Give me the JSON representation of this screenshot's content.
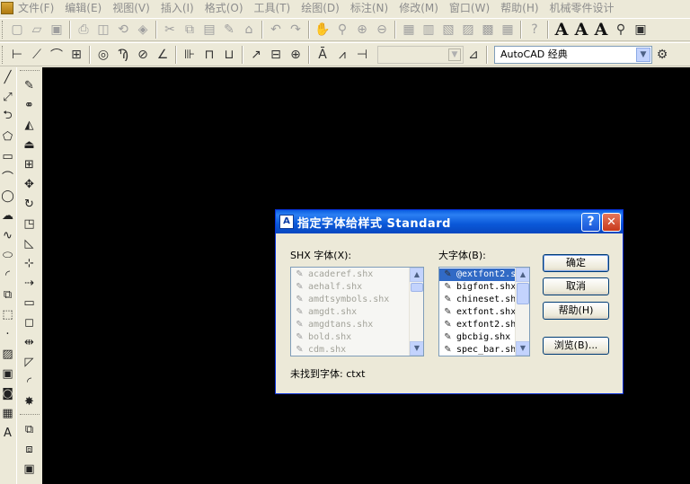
{
  "menu": {
    "items": [
      "文件(F)",
      "编辑(E)",
      "视图(V)",
      "插入(I)",
      "格式(O)",
      "工具(T)",
      "绘图(D)",
      "标注(N)",
      "修改(M)",
      "窗口(W)",
      "帮助(H)",
      "机械零件设计"
    ]
  },
  "toolbar": {
    "workspace_value": "AutoCAD 经典",
    "text_buttons": [
      "A",
      "A",
      "A"
    ]
  },
  "dialog": {
    "title": "指定字体给样式 Standard",
    "help_glyph": "?",
    "close_glyph": "✕",
    "shx_label": "SHX 字体(X):",
    "big_label": "大字体(B):",
    "shx_fonts": [
      "acaderef.shx",
      "aehalf.shx",
      "amdtsymbols.shx",
      "amgdt.shx",
      "amgdtans.shx",
      "bold.shx",
      "cdm.shx"
    ],
    "big_fonts": [
      "@extfont2.shx",
      "bigfont.shx",
      "chineset.shx",
      "extfont.shx",
      "extfont2.shx",
      "gbcbig.shx",
      "spec_bar.shx"
    ],
    "big_selected_index": 0,
    "buttons": {
      "ok": "确定",
      "cancel": "取消",
      "help": "帮助(H)",
      "browse": "浏览(B)..."
    },
    "status_text": "未找到字体: ctxt"
  },
  "colors": {
    "canvas": "#000000",
    "title_bar": "#0a5ee0",
    "selection": "#316ac5"
  }
}
